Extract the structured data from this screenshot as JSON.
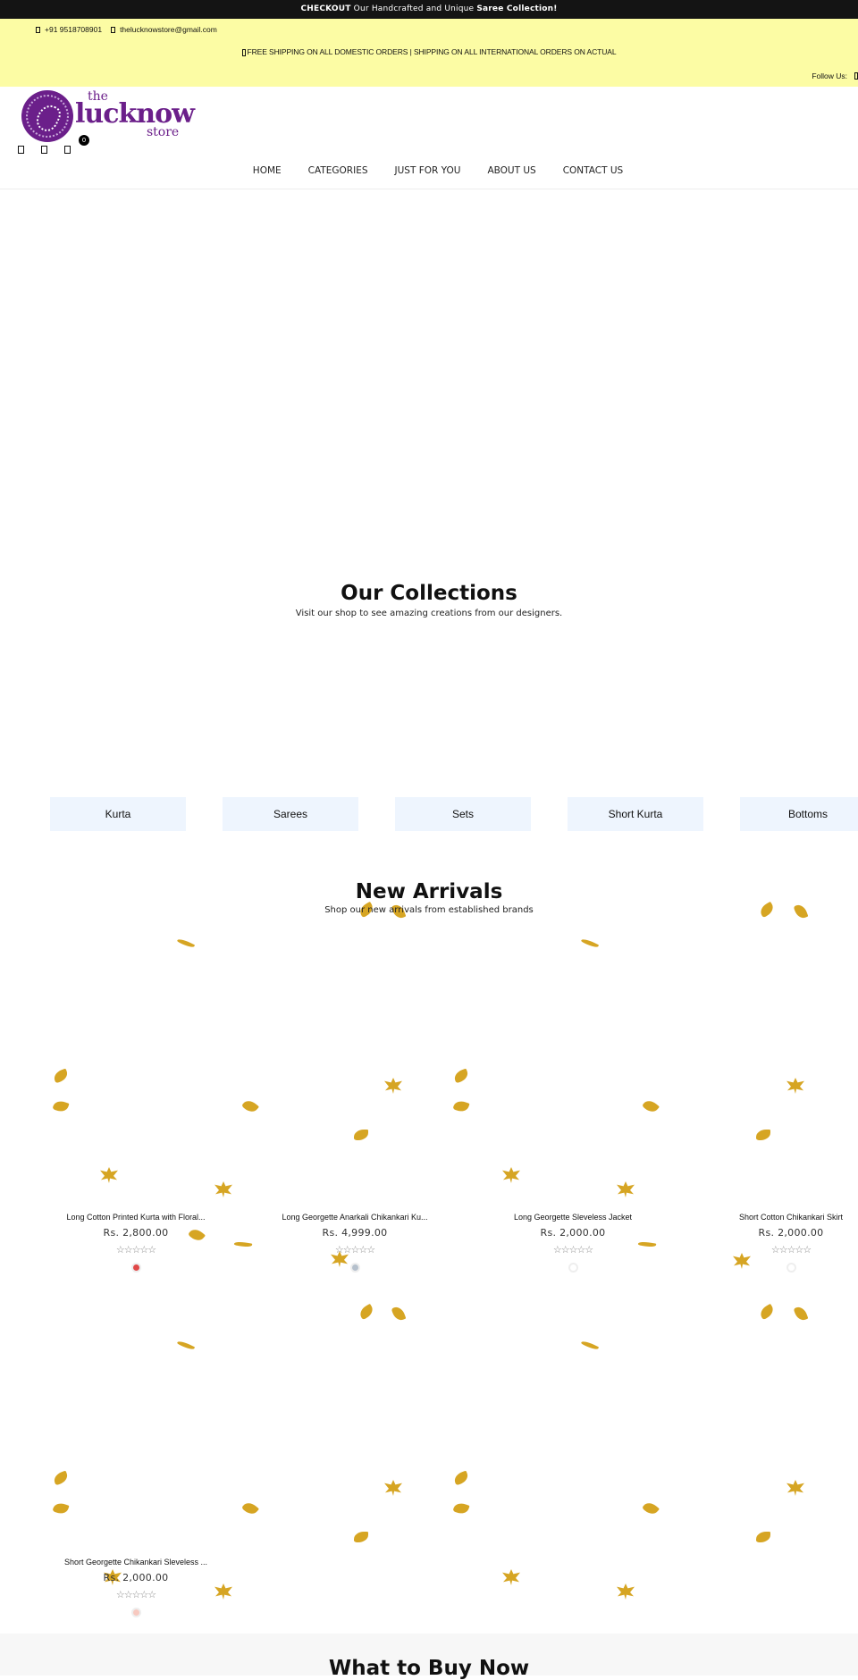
{
  "announcement": {
    "bold_prefix": "CHECKOUT",
    "text": " Our Handcrafted and Unique ",
    "bold_suffix": "Saree Collection!"
  },
  "topbar": {
    "phone": "+91 9518708901",
    "email": "thelucknowstore@gmail.com",
    "shipping": "FREE SHIPPING ON ALL DOMESTIC ORDERS | SHIPPING ON ALL INTERNATIONAL ORDERS ON ACTUAL",
    "follow_label": "Follow Us:"
  },
  "header": {
    "logo": {
      "the": "the",
      "name": "lucknow",
      "store": "store"
    },
    "cart_count": "0",
    "icons": [
      "search-icon",
      "user-icon",
      "cart-icon"
    ]
  },
  "nav": [
    "HOME",
    "CATEGORIES",
    "JUST FOR YOU",
    "ABOUT US",
    "CONTACT US"
  ],
  "collections": {
    "title": "Our Collections",
    "subtitle": "Visit our shop to see amazing creations from our designers.",
    "categories": [
      "Kurta",
      "Sarees",
      "Sets",
      "Short Kurta",
      "Bottoms"
    ]
  },
  "arrivals": {
    "title": "New Arrivals",
    "subtitle": "Shop our new arrivals from established brands",
    "products": [
      {
        "name": "Long Cotton Printed Kurta with Floral...",
        "price": "Rs. 2,800.00",
        "rating": 0,
        "swatch": "#e04848"
      },
      {
        "name": "Long Georgette Anarkali Chikankari Ku...",
        "price": "Rs. 4,999.00",
        "rating": 0,
        "swatch": "#b5c0cc"
      },
      {
        "name": "Long Georgette Sleveless Jacket",
        "price": "Rs. 2,000.00",
        "rating": 0,
        "swatch": "#ffffff"
      },
      {
        "name": "Short Cotton Chikankari Skirt",
        "price": "Rs. 2,000.00",
        "rating": 0,
        "swatch": "#ffffff"
      },
      {
        "name": "Short Georgette Chikankari Sleveless ...",
        "price": "Rs. 2,000.00",
        "rating": 0,
        "swatch": "#f7c9c0"
      }
    ],
    "stars_glyph": "☆☆☆☆☆"
  },
  "buy_now": {
    "title": "What to Buy Now"
  }
}
